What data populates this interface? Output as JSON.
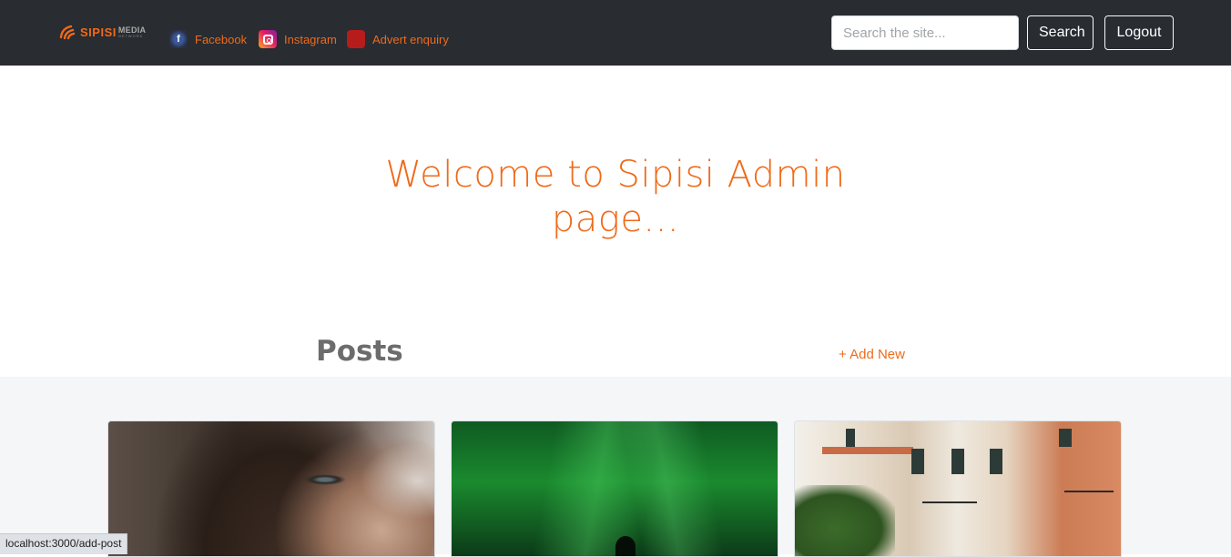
{
  "brand": {
    "wordmark": "SIPISI",
    "wordmark_suffix": "MEDIA",
    "wordmark_sub": "NETWORK"
  },
  "nav": {
    "links": [
      {
        "label": "Facebook",
        "icon": "facebook-icon"
      },
      {
        "label": "Instagram",
        "icon": "instagram-icon"
      },
      {
        "label": "Advert enquiry",
        "icon": "advert-icon"
      }
    ]
  },
  "search": {
    "placeholder": "Search the site...",
    "value": "",
    "button_label": "Search"
  },
  "logout_label": "Logout",
  "hero": {
    "title": "Welcome to Sipisi Admin page..."
  },
  "posts": {
    "title": "Posts",
    "add_new_label": "+ Add New",
    "cards": [
      {
        "image": "portrait-woman-image"
      },
      {
        "image": "aurora-green-sky-image"
      },
      {
        "image": "old-town-buildings-image"
      }
    ]
  },
  "status_bar": {
    "url": "localhost:3000/add-post"
  },
  "colors": {
    "navbar_bg": "#292c31",
    "accent": "#ef6a1a",
    "feed_bg": "#f4f6f8"
  }
}
